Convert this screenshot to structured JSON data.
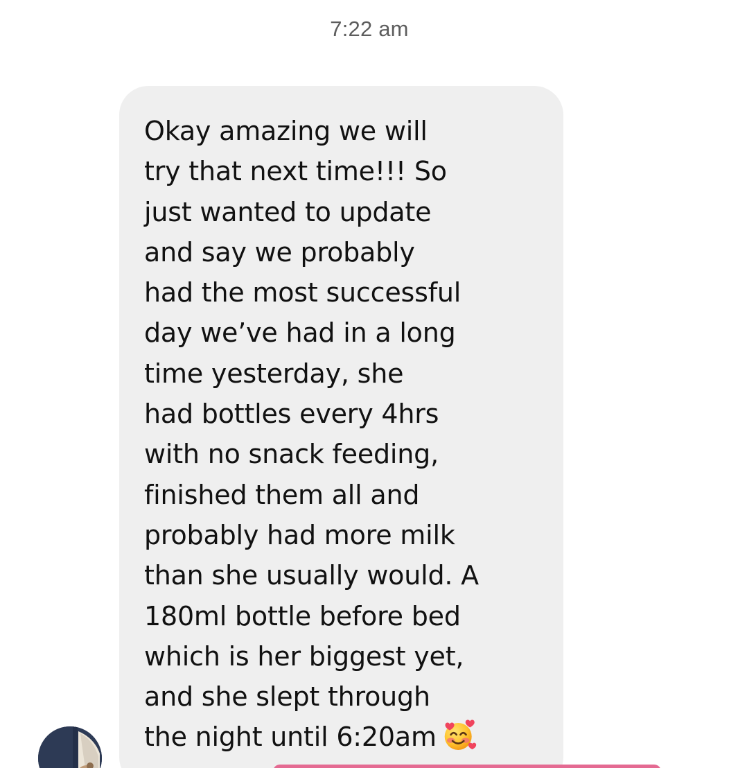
{
  "conversation": {
    "timestamp": "7:22 am",
    "message": {
      "lines": [
        "Okay amazing we will",
        "try that next time!!! So",
        "just wanted to update",
        "and say we probably",
        "had the most successful",
        "day we’ve had in a long",
        "time yesterday, she",
        "had bottles every 4hrs",
        "with no snack feeding,",
        "finished them all and",
        "probably had more milk",
        "than she usually would. A",
        "180ml bottle before bed",
        "which is her biggest yet,",
        "and she slept through",
        "the night until 6:20am"
      ],
      "emoji_icon": "smiling-face-with-hearts-icon"
    },
    "sender": {
      "avatar_icon": "avatar"
    }
  },
  "colors": {
    "bubble": "#efefef",
    "timestamp": "#5d5d5d",
    "text": "#111111",
    "accent": "#e46a92"
  }
}
